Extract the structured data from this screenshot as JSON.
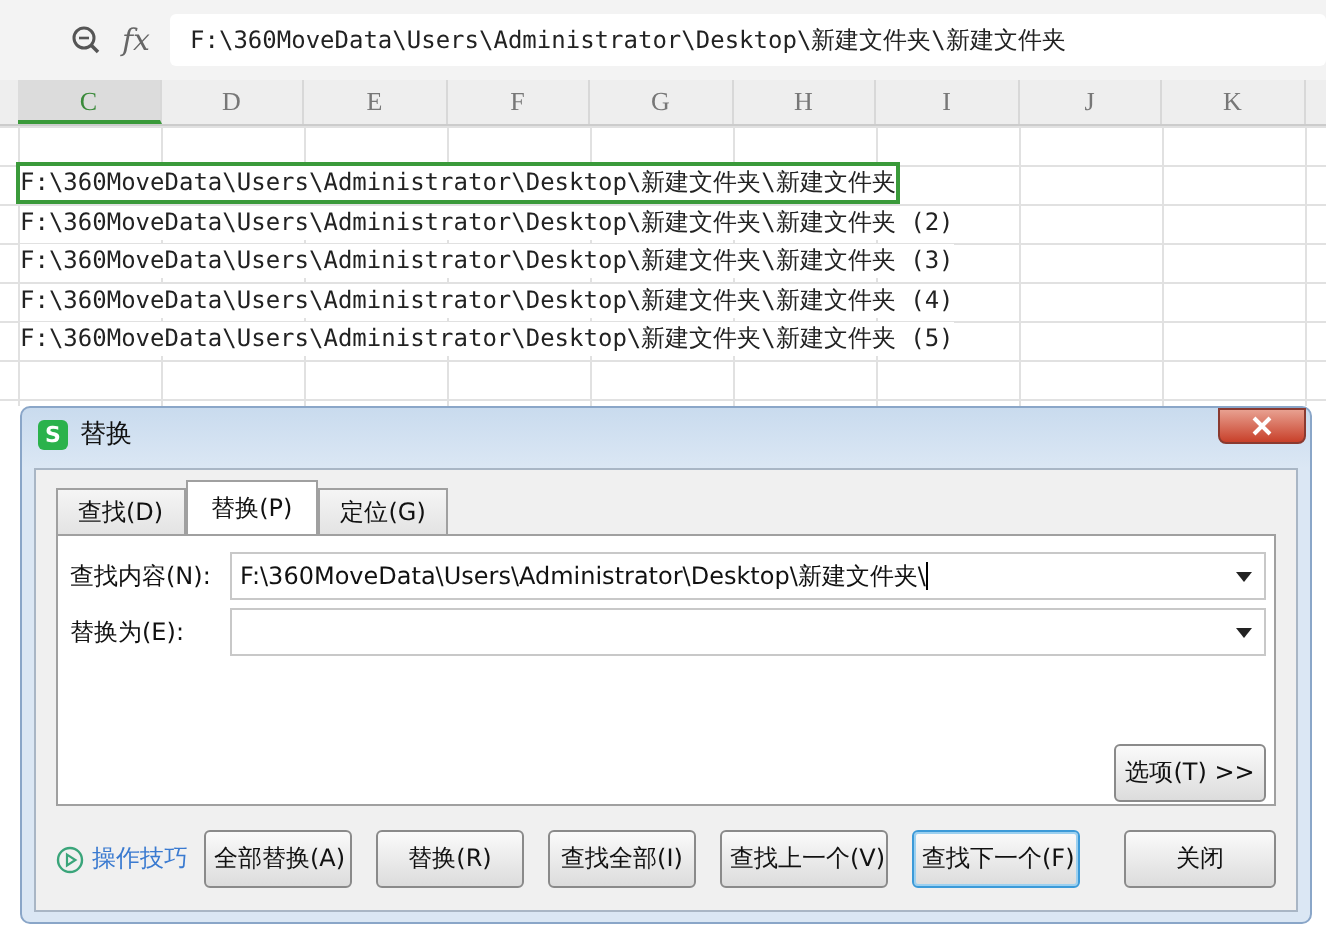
{
  "formula_bar": {
    "fx": "fx",
    "value": "F:\\360MoveData\\Users\\Administrator\\Desktop\\新建文件夹\\新建文件夹"
  },
  "columns": [
    {
      "label": "C",
      "selected": true
    },
    {
      "label": "D",
      "selected": false
    },
    {
      "label": "E",
      "selected": false
    },
    {
      "label": "F",
      "selected": false
    },
    {
      "label": "G",
      "selected": false
    },
    {
      "label": "H",
      "selected": false
    },
    {
      "label": "I",
      "selected": false
    },
    {
      "label": "J",
      "selected": false
    },
    {
      "label": "K",
      "selected": false
    }
  ],
  "cells": [
    {
      "text": "F:\\360MoveData\\Users\\Administrator\\Desktop\\新建文件夹\\新建文件夹",
      "selected": true
    },
    {
      "text": "F:\\360MoveData\\Users\\Administrator\\Desktop\\新建文件夹\\新建文件夹 (2)",
      "selected": false
    },
    {
      "text": "F:\\360MoveData\\Users\\Administrator\\Desktop\\新建文件夹\\新建文件夹 (3)",
      "selected": false
    },
    {
      "text": "F:\\360MoveData\\Users\\Administrator\\Desktop\\新建文件夹\\新建文件夹 (4)",
      "selected": false
    },
    {
      "text": "F:\\360MoveData\\Users\\Administrator\\Desktop\\新建文件夹\\新建文件夹 (5)",
      "selected": false
    }
  ],
  "dialog": {
    "title": "替换",
    "app_icon": "S",
    "tabs": [
      {
        "label": "查找(D)",
        "selected": false
      },
      {
        "label": "替换(P)",
        "selected": true
      },
      {
        "label": "定位(G)",
        "selected": false
      }
    ],
    "fields": [
      {
        "label": "查找内容(N):",
        "value": "F:\\360MoveData\\Users\\Administrator\\Desktop\\新建文件夹\\"
      },
      {
        "label": "替换为(E):"
      }
    ],
    "options_button": "选项(T) >>",
    "tips_link": "操作技巧",
    "buttons": [
      {
        "label": "全部替换(A)",
        "focused": false
      },
      {
        "label": "替换(R)",
        "focused": false
      },
      {
        "label": "查找全部(I)",
        "focused": false
      },
      {
        "label": "查找上一个(V)",
        "focused": false
      },
      {
        "label": "查找下一个(F)",
        "focused": true
      }
    ],
    "close_button": "关闭"
  }
}
